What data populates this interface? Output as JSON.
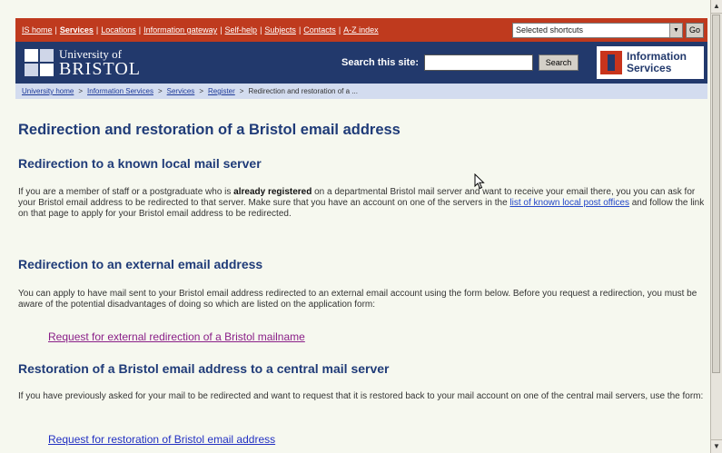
{
  "nav": {
    "links": [
      {
        "label": "IS home",
        "active": false
      },
      {
        "label": "Services",
        "active": true
      },
      {
        "label": "Locations",
        "active": false
      },
      {
        "label": "Information gateway",
        "active": false
      },
      {
        "label": "Self-help",
        "active": false
      },
      {
        "label": "Subjects",
        "active": false
      },
      {
        "label": "Contacts",
        "active": false
      },
      {
        "label": "A-Z index",
        "active": false
      }
    ],
    "shortcuts_selected": "Selected shortcuts",
    "go_label": "Go"
  },
  "header": {
    "university_line": "University of",
    "bristol_line": "BRISTOL",
    "search_label": "Search this site:",
    "search_value": "",
    "search_button": "Search",
    "is_logo_line1": "Information",
    "is_logo_line2": "Services"
  },
  "breadcrumb": {
    "items": [
      "University home",
      "Information Services",
      "Services",
      "Register"
    ],
    "current": "Redirection and restoration of a ..."
  },
  "content": {
    "title": "Redirection and restoration of a Bristol email address",
    "section1": {
      "heading": "Redirection to a known local mail server",
      "text_before": "If you are a member of staff or a postgraduate who is ",
      "text_bold": "already registered",
      "text_middle": " on a departmental Bristol mail server and want to receive your email there, you you can ask for your Bristol email address to be redirected to that server. Make sure that you have an account on one of the servers in the ",
      "link": "list of known local post offices",
      "text_after": " and follow the link on that page to apply for your Bristol email address to be redirected."
    },
    "section2": {
      "heading": "Redirection to an external email address",
      "text": "You can apply to have mail sent to your Bristol email address redirected to an external email account using the form below. Before you request a redirection, you must be aware of the potential disadvantages of doing so which are listed on the application form:",
      "link": "Request for external redirection of a Bristol mailname"
    },
    "section3": {
      "heading": "Restoration of a Bristol email address to a central mail server",
      "text": "If you have previously asked for your mail to be redirected and want to request that it is restored back to your mail account on one of the central mail servers, use the form:",
      "link": "Request for restoration of Bristol email address"
    }
  },
  "colors": {
    "nav_bg": "#bf3a1e",
    "header_bg": "#22396c",
    "breadcrumb_bg": "#d3dcef",
    "page_bg": "#f6f8ef",
    "heading": "#1f3b78",
    "visited_link": "#8a1f88",
    "link": "#2230c2"
  },
  "icons": {
    "scroll_up": "scroll-up-arrow-icon",
    "scroll_down": "scroll-down-arrow-icon",
    "dropdown": "dropdown-arrow-icon",
    "cursor": "mouse-pointer-icon"
  }
}
